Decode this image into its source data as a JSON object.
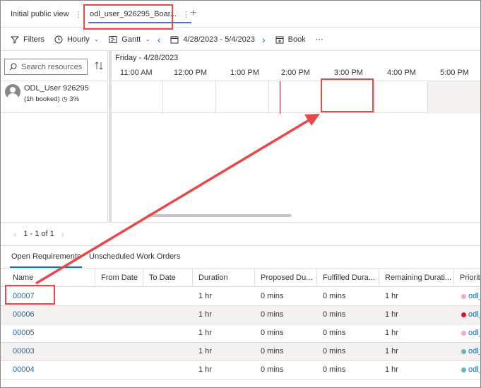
{
  "tabs": [
    {
      "label": "Initial public view"
    },
    {
      "label": "odl_user_926295_Boar..."
    }
  ],
  "toolbar": {
    "filters": "Filters",
    "hourly": "Hourly",
    "gantt": "Gantt",
    "date_range": "4/28/2023 - 5/4/2023",
    "book": "Book",
    "more": "⋯"
  },
  "resources": {
    "search_placeholder": "Search resources",
    "items": [
      {
        "name": "ODL_User 926295",
        "booked": "(1h booked)",
        "utilization": "3%"
      }
    ]
  },
  "gantt": {
    "date_label": "Friday - 4/28/2023",
    "hours": [
      "11:00 AM",
      "12:00 PM",
      "1:00 PM",
      "2:00 PM",
      "3:00 PM",
      "4:00 PM",
      "5:00 PM"
    ]
  },
  "pager": {
    "text": "1 - 1 of 1"
  },
  "bottom_tabs": [
    "Open Requirements",
    "Unscheduled Work Orders"
  ],
  "grid": {
    "columns": [
      "Name",
      "From Date",
      "To Date",
      "Duration",
      "Proposed Du...",
      "Fulfilled Dura...",
      "Remaining Durati...",
      "Priority"
    ],
    "rows": [
      {
        "name": "00007",
        "from": "",
        "to": "",
        "duration": "1 hr",
        "proposed": "0 mins",
        "fulfilled": "0 mins",
        "remaining": "1 hr",
        "priority": "odl_",
        "priority_color": "#f0a6d8"
      },
      {
        "name": "00006",
        "from": "",
        "to": "",
        "duration": "1 hr",
        "proposed": "0 mins",
        "fulfilled": "0 mins",
        "remaining": "1 hr",
        "priority": "odl_",
        "priority_color": "#e81123"
      },
      {
        "name": "00005",
        "from": "",
        "to": "",
        "duration": "1 hr",
        "proposed": "0 mins",
        "fulfilled": "0 mins",
        "remaining": "1 hr",
        "priority": "odl_",
        "priority_color": "#f0a6d8"
      },
      {
        "name": "00003",
        "from": "",
        "to": "",
        "duration": "1 hr",
        "proposed": "0 mins",
        "fulfilled": "0 mins",
        "remaining": "1 hr",
        "priority": "odl_",
        "priority_color": "#5bbcbc"
      },
      {
        "name": "00004",
        "from": "",
        "to": "",
        "duration": "1 hr",
        "proposed": "0 mins",
        "fulfilled": "0 mins",
        "remaining": "1 hr",
        "priority": "odl_",
        "priority_color": "#5bbcbc"
      }
    ]
  },
  "annotation_color": "#e8484a"
}
